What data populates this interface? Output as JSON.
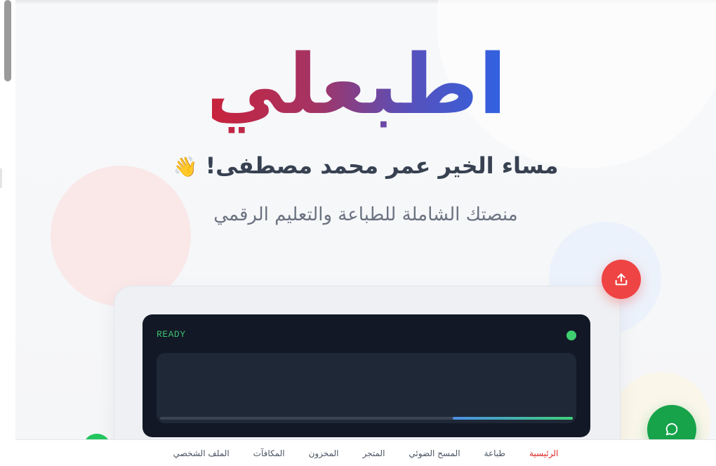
{
  "brand": {
    "logo_text": "اطبعلي",
    "gradient_colors": [
      "#c8233c",
      "#a43464",
      "#5a4fb8",
      "#2f63e3"
    ]
  },
  "hero": {
    "greeting": "مساء الخير عمر محمد مصطفى!",
    "greeting_emoji": "👋",
    "tagline": "منصتك الشاملة للطباعة والتعليم الرقمي"
  },
  "printer": {
    "status_text": "READY",
    "status_led_color": "#3fce70",
    "progress_fraction": 0.29
  },
  "fab": {
    "upload_icon": "upload-icon",
    "upload_color": "#ef4444",
    "chat_icon": "chat-bubble-icon",
    "chat_color": "#16a34a"
  },
  "bottom_nav": {
    "items": [
      {
        "label": "الرئيسية",
        "active": true
      },
      {
        "label": "طباعة",
        "active": false
      },
      {
        "label": "المسح الضوئي",
        "active": false
      },
      {
        "label": "المتجر",
        "active": false
      },
      {
        "label": "المخزون",
        "active": false
      },
      {
        "label": "المكافآت",
        "active": false
      },
      {
        "label": "الملف الشخصي",
        "active": false
      }
    ],
    "active_color": "#dc2626"
  }
}
